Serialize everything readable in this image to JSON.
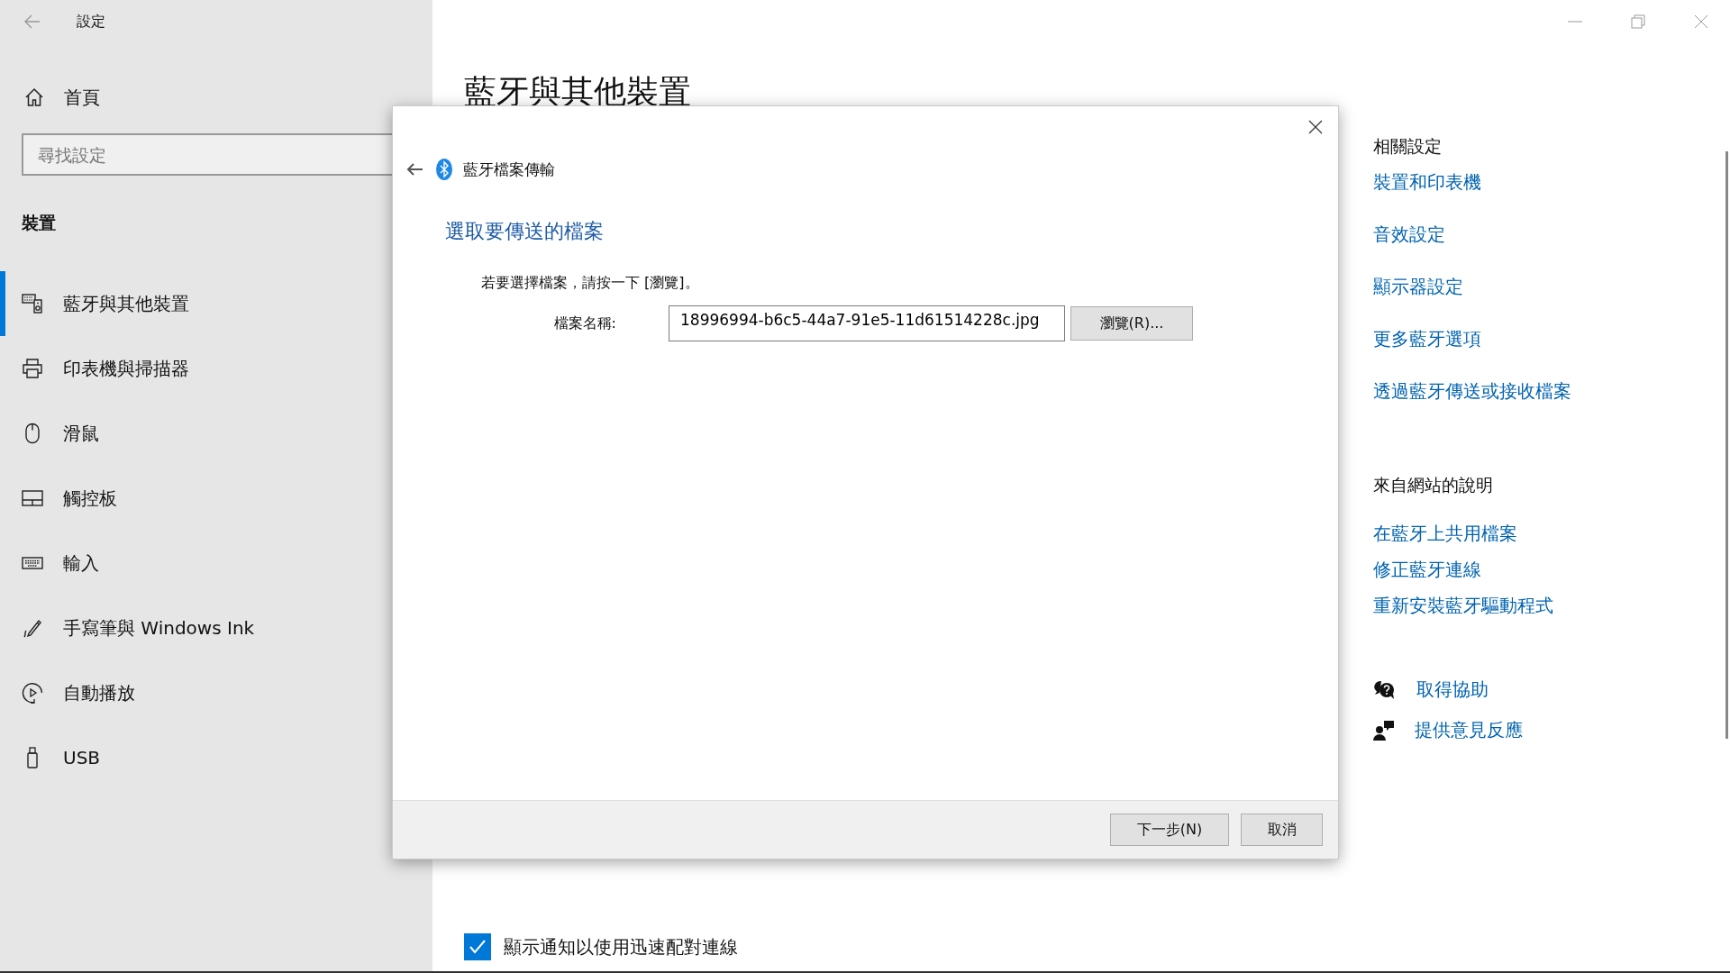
{
  "window": {
    "title": "設定"
  },
  "sidebar": {
    "home": "首頁",
    "search": {
      "placeholder": "尋找設定"
    },
    "section": "裝置",
    "items": [
      {
        "kind": "devices",
        "label": "藍牙與其他裝置",
        "selected": true
      },
      {
        "kind": "printer",
        "label": "印表機與掃描器",
        "selected": false
      },
      {
        "kind": "mouse",
        "label": "滑鼠",
        "selected": false
      },
      {
        "kind": "touchpad",
        "label": "觸控板",
        "selected": false
      },
      {
        "kind": "keyboard",
        "label": "輸入",
        "selected": false
      },
      {
        "kind": "pen",
        "label": "手寫筆與 Windows Ink",
        "selected": false
      },
      {
        "kind": "autoplay",
        "label": "自動播放",
        "selected": false
      },
      {
        "kind": "usb",
        "label": "USB",
        "selected": false
      }
    ]
  },
  "page": {
    "title": "藍牙與其他裝置",
    "swift_pair": {
      "label": "顯示通知以使用迅速配對連線",
      "checked": true
    }
  },
  "related": {
    "heading": "相關設定",
    "links": [
      "裝置和印表機",
      "音效設定",
      "顯示器設定",
      "更多藍牙選項",
      "透過藍牙傳送或接收檔案"
    ]
  },
  "web_help": {
    "heading": "來自網站的說明",
    "links": [
      "在藍牙上共用檔案",
      "修正藍牙連線",
      "重新安裝藍牙驅動程式"
    ]
  },
  "support": [
    {
      "kind": "help",
      "label": "取得協助"
    },
    {
      "kind": "feedback",
      "label": "提供意見反應"
    }
  ],
  "dialog": {
    "title": "藍牙檔案傳輸",
    "heading": "選取要傳送的檔案",
    "instruction": "若要選擇檔案，請按一下 [瀏覽]。",
    "file_label": "檔案名稱:",
    "file_name": "18996994-b6c5-44a7-91e5-11d61514228c.jpg",
    "browse": "瀏覽(R)...",
    "buttons": [
      "下一步(N)",
      "取消"
    ]
  }
}
